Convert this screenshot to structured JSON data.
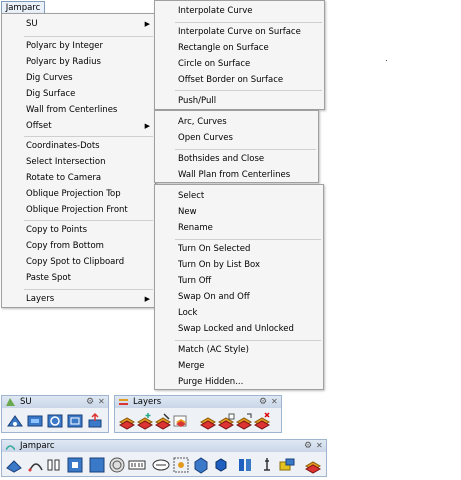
{
  "menubar": {
    "title": "Jamparc"
  },
  "main_menu": {
    "items": [
      {
        "label": "SU",
        "submenu": true
      },
      {
        "label": "Polyarc by Integer"
      },
      {
        "label": "Polyarc by Radius"
      },
      {
        "label": "Dig Curves"
      },
      {
        "label": "Dig Surface"
      },
      {
        "label": "Wall from Centerlines"
      },
      {
        "label": "Offset",
        "submenu": true
      },
      {
        "label": "Coordinates-Dots"
      },
      {
        "label": "Select Intersection"
      },
      {
        "label": "Rotate to Camera"
      },
      {
        "label": "Oblique Projection Top"
      },
      {
        "label": "Oblique Projection Front"
      },
      {
        "label": "Copy to Points"
      },
      {
        "label": "Copy from Bottom"
      },
      {
        "label": "Copy Spot to Clipboard"
      },
      {
        "label": "Paste Spot"
      },
      {
        "label": "Layers",
        "submenu": true
      }
    ]
  },
  "su_submenu": {
    "items": [
      {
        "label": "Interpolate Curve"
      },
      {
        "label": "Interpolate Curve on Surface"
      },
      {
        "label": "Rectangle on Surface"
      },
      {
        "label": "Circle on Surface"
      },
      {
        "label": "Offset Border on Surface"
      },
      {
        "label": "Push/Pull"
      }
    ]
  },
  "offset_submenu": {
    "items": [
      {
        "label": "Arc, Curves"
      },
      {
        "label": "Open Curves"
      },
      {
        "label": "Bothsides and Close"
      },
      {
        "label": "Wall Plan from Centerlines"
      }
    ]
  },
  "layers_submenu": {
    "items": [
      {
        "label": "Select"
      },
      {
        "label": "New"
      },
      {
        "label": "Rename"
      },
      {
        "label": "Turn On Selected"
      },
      {
        "label": "Turn On by List Box"
      },
      {
        "label": "Turn Off"
      },
      {
        "label": "Swap On and Off"
      },
      {
        "label": "Lock"
      },
      {
        "label": "Swap Locked and Unlocked"
      },
      {
        "label": "Match (AC Style)"
      },
      {
        "label": "Merge"
      },
      {
        "label": "Purge Hidden..."
      }
    ]
  },
  "toolbars": {
    "su": {
      "title": "SU",
      "icons": [
        "select-curve-icon",
        "rectangle-surface-icon",
        "circle-surface-icon",
        "offset-surface-icon",
        "push-pull-icon"
      ]
    },
    "layers": {
      "title": "Layers",
      "icons": [
        "layer-select-icon",
        "layer-new-icon",
        "layer-rename-icon",
        "layer-turn-on-icon",
        "layer-list-icon",
        "layer-turn-off-icon",
        "layer-swap-icon",
        "layer-lock-icon",
        "layer-purge-icon"
      ]
    },
    "jamparc": {
      "title": "Jamparc",
      "icons": [
        "polyarc-integer-icon",
        "polyarc-radius-icon",
        "dig-curves-icon",
        "dig-surface-icon",
        "wall-centerlines-icon",
        "offset-icon",
        "coordinates-dots-icon",
        "select-intersection-icon",
        "rotate-camera-icon",
        "oblique-top-icon",
        "oblique-front-icon",
        "copy-points-icon",
        "copy-bottom-icon",
        "copy-spot-icon",
        "paste-spot-icon",
        "layers-icon"
      ]
    }
  },
  "colors": {
    "menu_bg": "#f5f5f5",
    "toolbar_bg": "#eef2f7",
    "accent": "#1f5fbf"
  }
}
